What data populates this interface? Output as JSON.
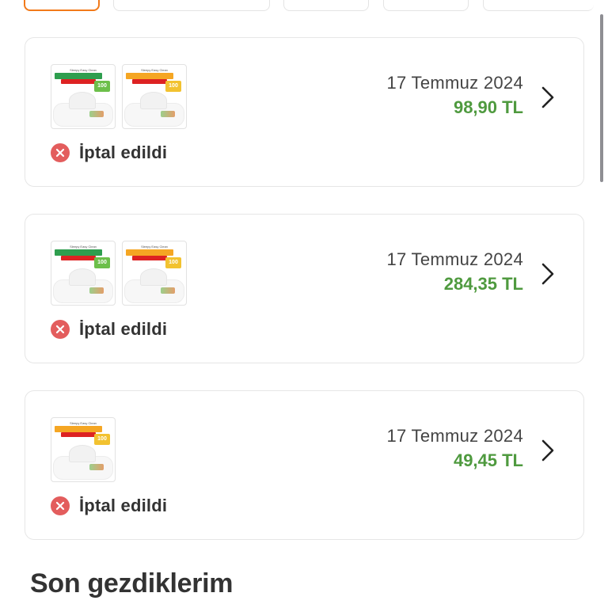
{
  "filters": {
    "chips": [
      "",
      "",
      "",
      "",
      ""
    ]
  },
  "orders": [
    {
      "date": "17 Temmuz 2024",
      "price": "98,90 TL",
      "status": "İptal edildi",
      "products": [
        {
          "top_text": "Sleepy Easy Clean",
          "band_text": "Yüzey Temizlik Havlusu",
          "sub_text": "Tüm Yüzeyler",
          "band_color": "#2e9e4e",
          "badge": "100",
          "badge_style": "green"
        },
        {
          "top_text": "Sleepy Easy Clean",
          "band_text": "Yüzey Temizlik Havlusu",
          "sub_text": "Tüm Yüzeyler",
          "band_color": "#f5a623",
          "badge": "100",
          "badge_style": "yellow"
        }
      ]
    },
    {
      "date": "17 Temmuz 2024",
      "price": "284,35 TL",
      "status": "İptal edildi",
      "products": [
        {
          "top_text": "Sleepy Easy Clean",
          "band_text": "Yüzey Temizlik Havlusu",
          "sub_text": "Tüm Yüzeyler",
          "band_color": "#2e9e4e",
          "badge": "100",
          "badge_style": "green"
        },
        {
          "top_text": "Sleepy Easy Clean",
          "band_text": "Yüzey Temizlik Havlusu",
          "sub_text": "Tüm Yüzeyler",
          "band_color": "#f5a623",
          "badge": "100",
          "badge_style": "yellow"
        }
      ]
    },
    {
      "date": "17 Temmuz 2024",
      "price": "49,45 TL",
      "status": "İptal edildi",
      "products": [
        {
          "top_text": "Sleepy Easy Clean",
          "band_text": "Yüzey Temizlik Havlusu",
          "sub_text": "Tüm Yüzeyler",
          "band_color": "#f5a623",
          "badge": "100",
          "badge_style": "yellow"
        }
      ]
    }
  ],
  "recent": {
    "title": "Son gezdiklerim"
  },
  "colors": {
    "accent": "#f27a1a",
    "price": "#4f9a3f",
    "cancel": "#e35d5d"
  },
  "icons": {
    "status": "cancel-circle-icon",
    "row_action": "chevron-right-icon"
  }
}
